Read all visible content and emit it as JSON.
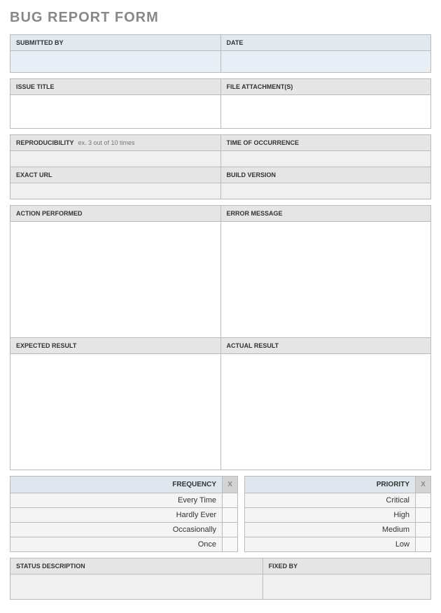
{
  "title": "BUG REPORT FORM",
  "section1": {
    "submitted_by_label": "SUBMITTED BY",
    "submitted_by": "",
    "date_label": "DATE",
    "date": ""
  },
  "section2": {
    "issue_title_label": "ISSUE TITLE",
    "issue_title": "",
    "file_attach_label": "FILE ATTACHMENT(S)",
    "file_attach": ""
  },
  "section3": {
    "repro_label": "REPRODUCIBILITY",
    "repro_hint": "ex. 3 out of 10 times",
    "repro": "",
    "time_label": "TIME OF OCCURRENCE",
    "time": "",
    "url_label": "EXACT URL",
    "url": "",
    "build_label": "BUILD VERSION",
    "build": ""
  },
  "section4": {
    "action_label": "ACTION PERFORMED",
    "action": "",
    "error_label": "ERROR MESSAGE",
    "error": "",
    "expected_label": "EXPECTED RESULT",
    "expected": "",
    "actual_label": "ACTUAL RESULT",
    "actual": ""
  },
  "frequency": {
    "header": "FREQUENCY",
    "x_header": "X",
    "options": [
      "Every Time",
      "Hardly Ever",
      "Occasionally",
      "Once"
    ],
    "selected": [
      "",
      "",
      "",
      ""
    ]
  },
  "priority": {
    "header": "PRIORITY",
    "x_header": "X",
    "options": [
      "Critical",
      "High",
      "Medium",
      "Low"
    ],
    "selected": [
      "",
      "",
      "",
      ""
    ]
  },
  "status": {
    "status_label": "STATUS DESCRIPTION",
    "status_desc": "",
    "fixed_label": "FIXED BY",
    "fixed_by": ""
  }
}
